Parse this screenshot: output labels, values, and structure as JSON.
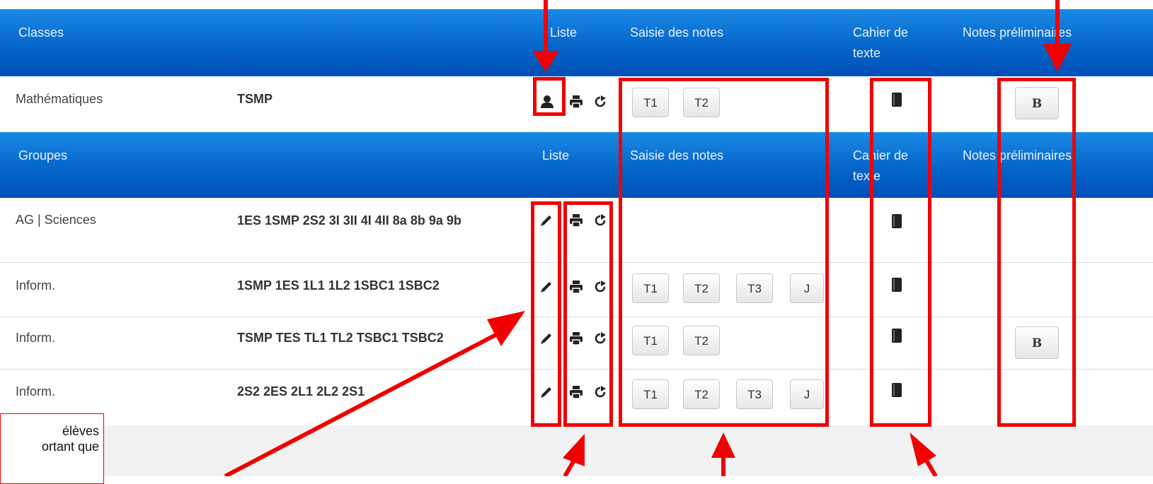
{
  "classes_header": {
    "col_name": "Classes",
    "col_list": "Liste",
    "col_notes": "Saisie des notes",
    "col_cahier": "Cahier de texte",
    "col_prelim": "Notes préliminaires"
  },
  "classes_rows": [
    {
      "subject": "Mathématiques",
      "classes": "TSMP",
      "terms": [
        "T1",
        "T2"
      ],
      "prelim": "B"
    }
  ],
  "groups_header": {
    "col_name": "Groupes",
    "col_list": "Liste",
    "col_notes": "Saisie des notes",
    "col_cahier": "Cahier de texte",
    "col_prelim": "Notes préliminaires"
  },
  "groups_rows": [
    {
      "subject": "AG | Sciences",
      "classes": "1ES 1SMP 2S2 3I 3II 4I 4II 8a 8b 9a 9b"
    },
    {
      "subject": "Inform.",
      "classes": "1SMP 1ES 1L1 1L2 1SBC1 1SBC2",
      "terms": [
        "T1",
        "T2",
        "T3",
        "J"
      ]
    },
    {
      "subject": "Inform.",
      "classes": "TSMP TES TL1 TL2 TSBC1 TSBC2",
      "terms": [
        "T1",
        "T2"
      ],
      "prelim": "B"
    },
    {
      "subject": "Inform.",
      "classes": "2S2 2ES 2L1 2L2 2S1",
      "terms": [
        "T1",
        "T2",
        "T3",
        "J"
      ]
    }
  ],
  "note_text": "élèves\nortant que",
  "icons": [
    "user-icon",
    "print-icon",
    "export-icon",
    "pencil-icon",
    "notebook-icon"
  ],
  "annotation_color": "#f00000"
}
